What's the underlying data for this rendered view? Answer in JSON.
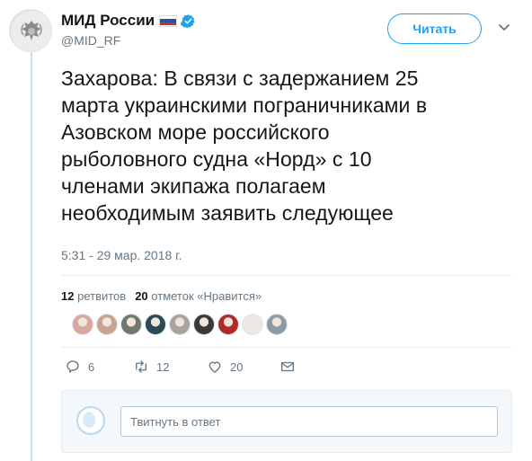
{
  "author": {
    "display_name": "МИД России",
    "handle": "@MID_RF",
    "verified": true,
    "avatar_icon": "coat-of-arms-icon"
  },
  "follow_button_label": "Читать",
  "tweet": {
    "lines": [
      "Захарова: В связи с задержанием 25",
      "марта украинскими пограничниками в",
      "Азовском море российского",
      "рыболовного судна «Норд» с 10",
      "членами экипажа полагаем",
      "необходимым заявить следующее"
    ],
    "timestamp": "5:31 - 29 мар. 2018 г."
  },
  "stats": {
    "retweets_count": "12",
    "retweets_label": "ретвитов",
    "likes_count": "20",
    "likes_label": "отметок «Нравится»"
  },
  "likers_colors": [
    "#d9a6a0",
    "#c8a48e",
    "#6e7a6b",
    "#2a4a55",
    "#a9a39a",
    "#3a3a3a",
    "#b02a2a",
    "#e9e9e9",
    "#8f9aa3"
  ],
  "actions": {
    "reply_count": "6",
    "retweet_count": "12",
    "like_count": "20"
  },
  "reply": {
    "placeholder": "Твитнуть в ответ"
  },
  "colors": {
    "accent": "#1da1f2",
    "text_secondary": "#657786",
    "thread_line": "#c8dfef"
  }
}
